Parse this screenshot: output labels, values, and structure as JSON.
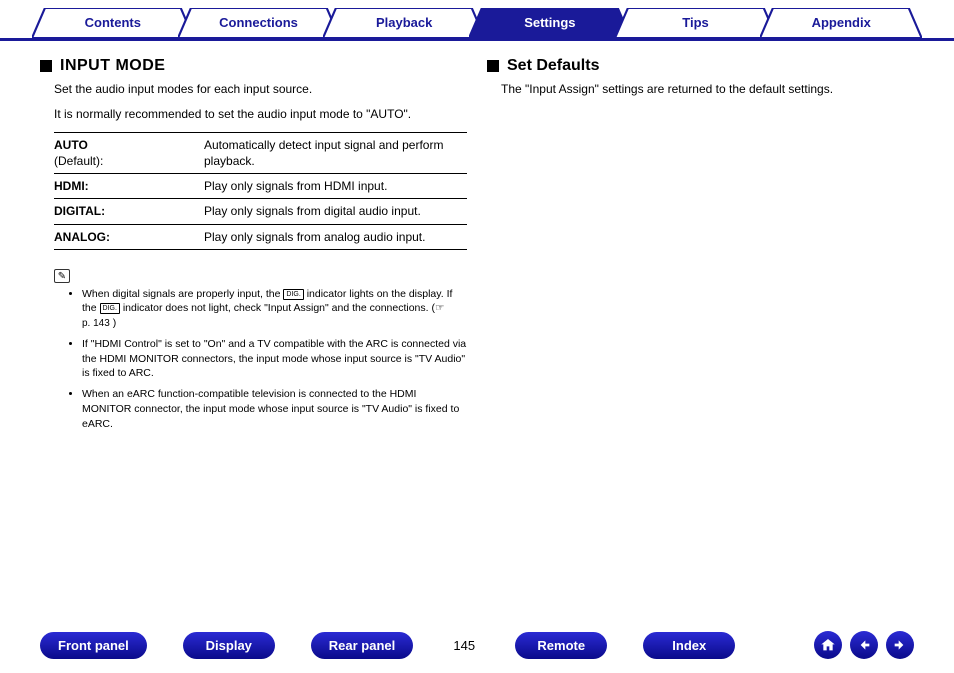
{
  "nav": {
    "tabs": [
      {
        "label": "Contents",
        "active": false
      },
      {
        "label": "Connections",
        "active": false
      },
      {
        "label": "Playback",
        "active": false
      },
      {
        "label": "Settings",
        "active": true
      },
      {
        "label": "Tips",
        "active": false
      },
      {
        "label": "Appendix",
        "active": false
      }
    ]
  },
  "left": {
    "title": "Input Mode",
    "intro1": "Set the audio input modes for each input source.",
    "intro2": "It is normally recommended to set the audio input mode to \"AUTO\".",
    "rows": [
      {
        "label": "AUTO",
        "sublabel": "(Default):",
        "desc": "Automatically detect input signal and perform playback."
      },
      {
        "label": "HDMI:",
        "sublabel": "",
        "desc": "Play only signals from HDMI input."
      },
      {
        "label": "DIGITAL:",
        "sublabel": "",
        "desc": "Play only signals from digital audio input."
      },
      {
        "label": "ANALOG:",
        "sublabel": "",
        "desc": "Play only signals from analog audio input."
      }
    ],
    "note_icon": "✎",
    "dig_badge": "DIG.",
    "page_ref": "p. 143",
    "notes": {
      "n1a": "When digital signals are properly input, the ",
      "n1b": " indicator lights on the display. If the ",
      "n1c": " indicator does not light, check \"Input Assign\" and the connections. (☞ ",
      "n1d": ")",
      "n2": "If \"HDMI Control\" is set to \"On\" and a TV compatible with the ARC is connected via the HDMI MONITOR connectors, the input mode whose input source is \"TV Audio\" is fixed to ARC.",
      "n3": "When an eARC function-compatible television is connected to the HDMI MONITOR connector, the input mode whose input source is \"TV Audio\" is fixed to eARC."
    }
  },
  "right": {
    "title": "Set Defaults",
    "text": "The \"Input Assign\" settings are returned to the default settings."
  },
  "bottom": {
    "buttons": [
      "Front panel",
      "Display",
      "Rear panel"
    ],
    "page": "145",
    "buttons2": [
      "Remote",
      "Index"
    ]
  }
}
